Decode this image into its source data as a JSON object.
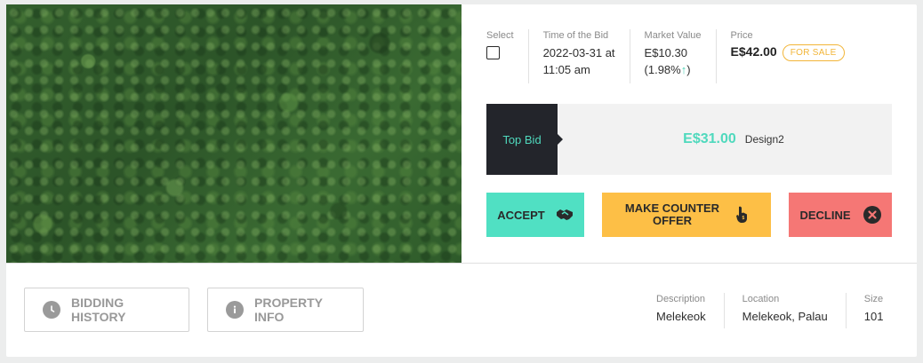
{
  "select": {
    "label": "Select",
    "checked": false
  },
  "bid_time": {
    "label": "Time of the Bid",
    "line1": "2022-03-31 at",
    "line2": "11:05 am"
  },
  "market": {
    "label": "Market Value",
    "value": "E$10.30",
    "change_open": "(1.98%",
    "change_arrow": "↑",
    "change_close": ")"
  },
  "price": {
    "label": "Price",
    "value": "E$42.00",
    "badge": "FOR SALE"
  },
  "top_bid": {
    "label": "Top Bid",
    "amount": "E$31.00",
    "user": "Design2"
  },
  "actions": {
    "accept": "ACCEPT",
    "counter_line1": "MAKE COUNTER",
    "counter_line2": "OFFER",
    "decline": "DECLINE"
  },
  "bottom_buttons": {
    "history": "BIDDING HISTORY",
    "info": "PROPERTY INFO"
  },
  "details": {
    "description": {
      "label": "Description",
      "value": "Melekeok"
    },
    "location": {
      "label": "Location",
      "value": "Melekeok, Palau"
    },
    "size": {
      "label": "Size",
      "value": "101"
    }
  },
  "colors": {
    "accent": "#50e0c3",
    "counter": "#fdbf46",
    "decline": "#f57775",
    "badge": "#f2b538",
    "dark": "#23252b"
  }
}
